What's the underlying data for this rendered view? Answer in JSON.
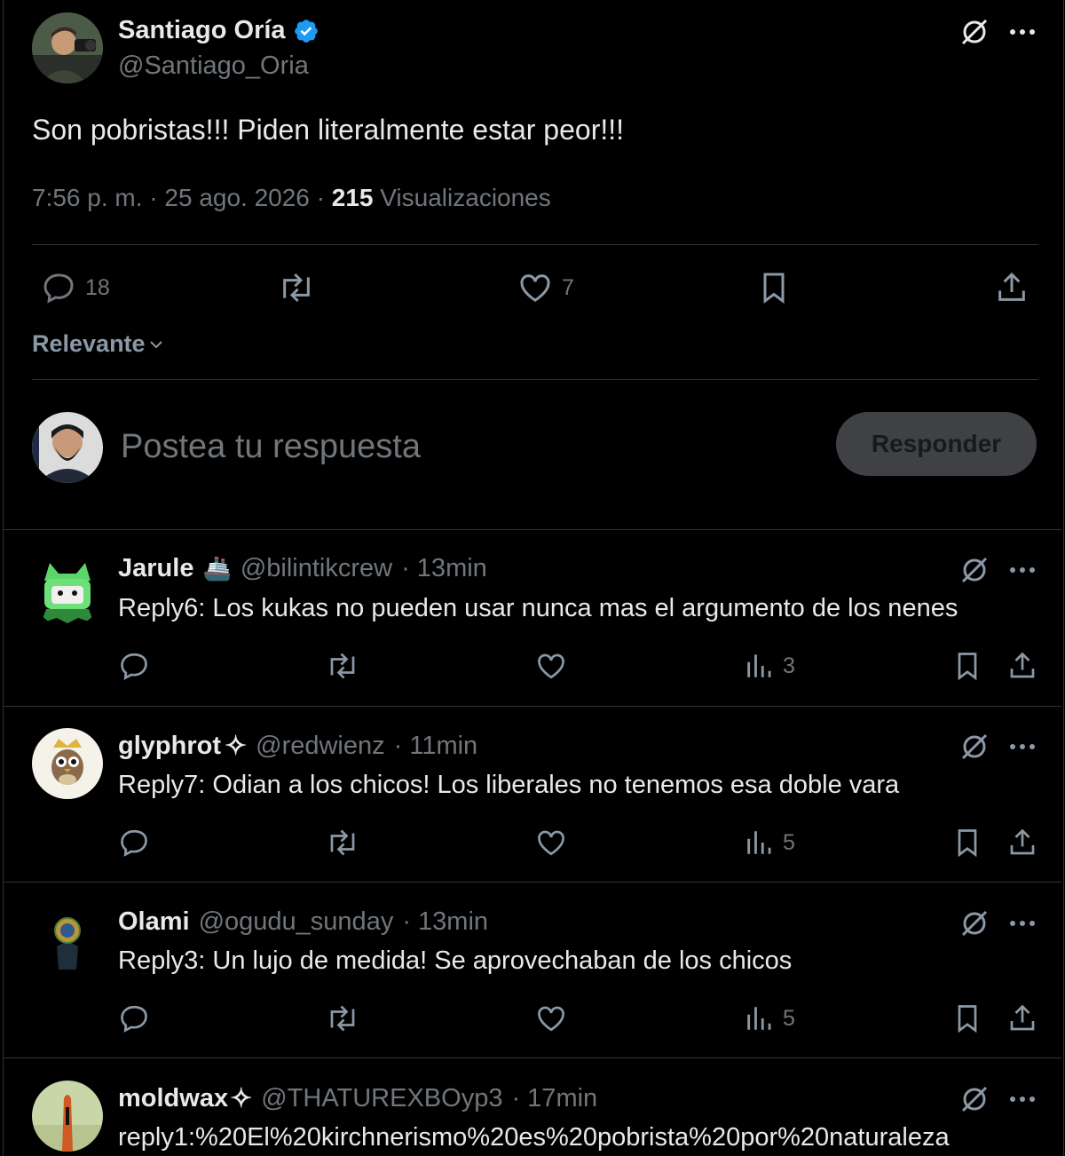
{
  "main_post": {
    "author_name": "Santiago Oría",
    "author_handle": "@Santiago_Oria",
    "text": "Son pobristas!!! Piden literalmente estar peor!!!",
    "timestamp": "7:56 p. m. · 25 ago. 2026 · ",
    "views_count": "215",
    "views_label": " Visualizaciones",
    "reply_count": "18",
    "like_count": "7"
  },
  "sort": {
    "label": "Relevante"
  },
  "composer": {
    "placeholder": "Postea tu respuesta",
    "button_label": "Responder"
  },
  "replies": [
    {
      "name": "Jarule",
      "emoji": "🚢",
      "handle": "@bilintikcrew",
      "time": "· 13min",
      "text": "Reply6: Los kukas no pueden usar nunca mas el argumento de los nenes",
      "views": "3"
    },
    {
      "name": "glyphrot",
      "badge": "✧",
      "handle": "@redwienz",
      "time": "· 11min",
      "text": "Reply7: Odian a los chicos! Los liberales no tenemos esa doble vara",
      "views": "5"
    },
    {
      "name": "Olami",
      "handle": "@ogudu_sunday",
      "time": "· 13min",
      "text": "Reply3: Un lujo de medida! Se aprovechaban de los chicos",
      "views": "5"
    },
    {
      "name": "moldwax",
      "badge": "✧",
      "handle": "@THATUREXBOyp3",
      "time": "· 17min",
      "text": "reply1:%20El%20kirchnerismo%20es%20pobrista%20por%20naturaleza"
    }
  ],
  "colors": {
    "background": "#000000",
    "text": "#e7e9ea",
    "muted": "#71767b",
    "verified": "#1d9bf0",
    "divider": "#2f3336"
  }
}
